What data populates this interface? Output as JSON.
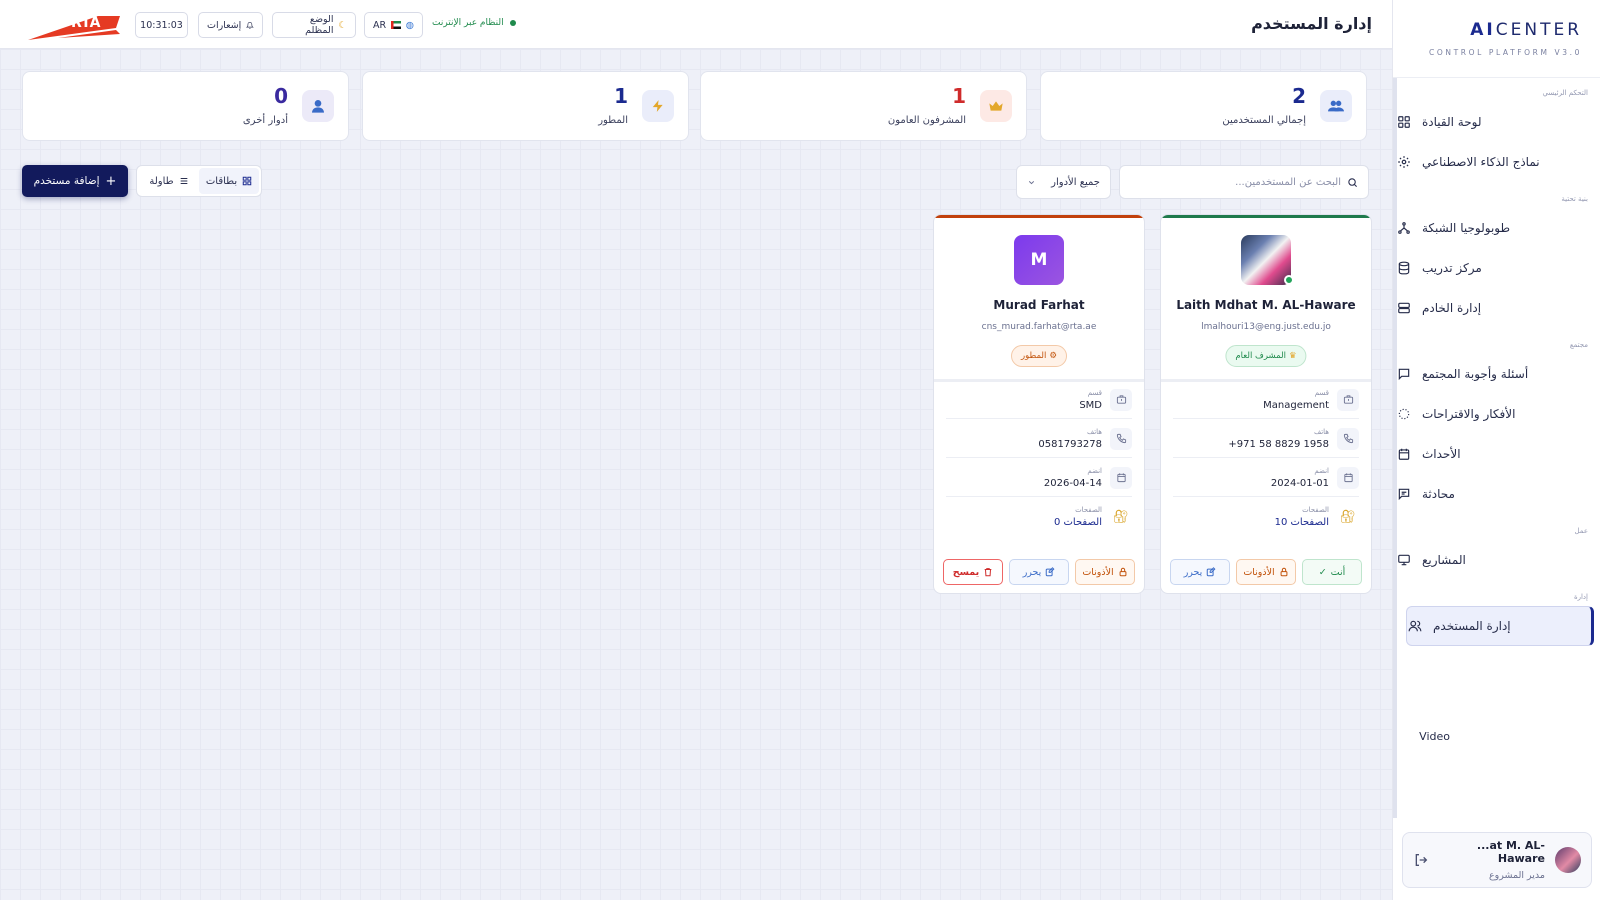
{
  "sidebar": {
    "brand_prefix": "AI",
    "brand_suffix": "CENTER",
    "brand_sub": "CONTROL PLATFORM V3.0",
    "sections": [
      "التحكم الرئيسي",
      "بنية تحتية",
      "مجتمع",
      "عمل",
      "إدارة"
    ],
    "items": [
      {
        "label": "لوحة القيادة",
        "icon": "dashboard-icon"
      },
      {
        "label": "نماذج الذكاء الاصطناعي",
        "icon": "ai-models-icon"
      },
      {
        "label": "طوبولوجيا الشبكة",
        "icon": "network-icon"
      },
      {
        "label": "مركز تدريب",
        "icon": "database-icon"
      },
      {
        "label": "إدارة الخادم",
        "icon": "server-icon"
      },
      {
        "label": "أسئلة وأجوبة المجتمع",
        "icon": "chat-icon"
      },
      {
        "label": "الأفكار والاقتراحات",
        "icon": "ideas-icon"
      },
      {
        "label": "الأحداث",
        "icon": "calendar-icon"
      },
      {
        "label": "محادثة",
        "icon": "message-icon"
      },
      {
        "label": "المشاريع",
        "icon": "monitor-icon"
      },
      {
        "label": "إدارة المستخدم",
        "icon": "users-icon"
      }
    ],
    "video_label": "Video",
    "user": {
      "name": "...at M. AL-Haware",
      "role": "مدير المشروع"
    }
  },
  "topbar": {
    "title": "إدارة المستخدم",
    "logo_text": "RTA",
    "time": "10:31:03",
    "notifications": "إشعارات",
    "dark_mode": "الوضع المظلم",
    "lang": "AR",
    "status": "النظام عبر الإنترنت"
  },
  "stats": [
    {
      "value": "2",
      "label": "إجمالي المستخدمين",
      "color": "#1b2a8f",
      "icon": "users-icon"
    },
    {
      "value": "1",
      "label": "المشرفون العامون",
      "color": "#cf2b2b",
      "icon": "crown-icon"
    },
    {
      "value": "1",
      "label": "المطور",
      "color": "#1b2a8f",
      "icon": "bolt-icon"
    },
    {
      "value": "0",
      "label": "أدوار أخرى",
      "color": "#3a2a9f",
      "icon": "person-icon"
    }
  ],
  "toolbar": {
    "search_placeholder": "البحث عن المستخدمين...",
    "roles_filter": "جميع الأدوار",
    "view_cards": "بطاقات",
    "view_table": "طاولة",
    "add_user": "إضافة مستخدم"
  },
  "users": [
    {
      "name": "Laith Mdhat M. AL-Haware",
      "email": "lmalhouri13@eng.just.edu.jo",
      "role": "المشرف العام",
      "accent": "#1f7a4c",
      "dept_label": "قسم",
      "dept": "Management",
      "phone_label": "هاتف",
      "phone": "+971 58 8829 1958",
      "joined_label": "انضم",
      "joined": "2024-01-01",
      "pages_label": "الصفحات",
      "pages": "10 الصفحات",
      "actions": [
        "أنت",
        "الأذونات",
        "يحرر"
      ]
    },
    {
      "name": "Murad Farhat",
      "email": "cns_murad.farhat@rta.ae",
      "initial": "M",
      "role": "المطور",
      "accent": "#c2410c",
      "dept_label": "قسم",
      "dept": "SMD",
      "phone_label": "هاتف",
      "phone": "0581793278",
      "joined_label": "انضم",
      "joined": "2026-04-14",
      "pages_label": "الصفحات",
      "pages": "0 الصفحات",
      "actions": [
        "الأذونات",
        "يحرر",
        "يمسح"
      ]
    }
  ]
}
